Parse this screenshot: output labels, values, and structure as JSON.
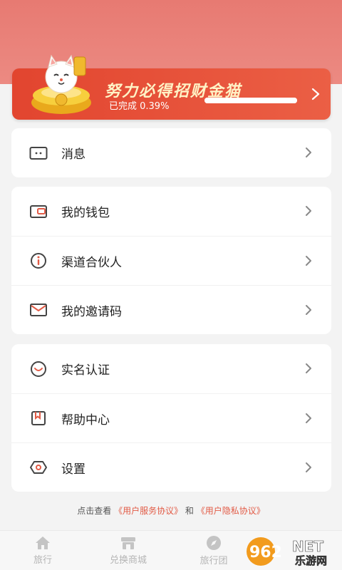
{
  "banner": {
    "title": "努力必得招财金猫",
    "progress_text": "已完成 0.39%",
    "progress_fraction": 0.0039
  },
  "groups": [
    {
      "items": [
        {
          "label": "消息",
          "icon": "message-icon"
        }
      ]
    },
    {
      "items": [
        {
          "label": "我的钱包",
          "icon": "wallet-icon"
        },
        {
          "label": "渠道合伙人",
          "icon": "info-icon"
        },
        {
          "label": "我的邀请码",
          "icon": "mail-icon"
        }
      ]
    },
    {
      "items": [
        {
          "label": "实名认证",
          "icon": "smile-icon"
        },
        {
          "label": "帮助中心",
          "icon": "bookmark-icon"
        },
        {
          "label": "设置",
          "icon": "settings-icon"
        }
      ]
    }
  ],
  "footer": {
    "prefix": "点击查看",
    "service_link": "《用户服务协议》",
    "and": "和",
    "privacy_link": "《用户隐私协议》"
  },
  "tabs": [
    {
      "label": "旅行",
      "icon": "home-icon"
    },
    {
      "label": "兑换商城",
      "icon": "store-icon"
    },
    {
      "label": "旅行团",
      "icon": "compass-icon"
    }
  ],
  "watermark": {
    "text1": "962",
    "text2": "NET",
    "text3": "乐游网"
  },
  "colors": {
    "accent": "#e2452f",
    "banner_title": "#fff3c6",
    "link": "#e25b46"
  }
}
